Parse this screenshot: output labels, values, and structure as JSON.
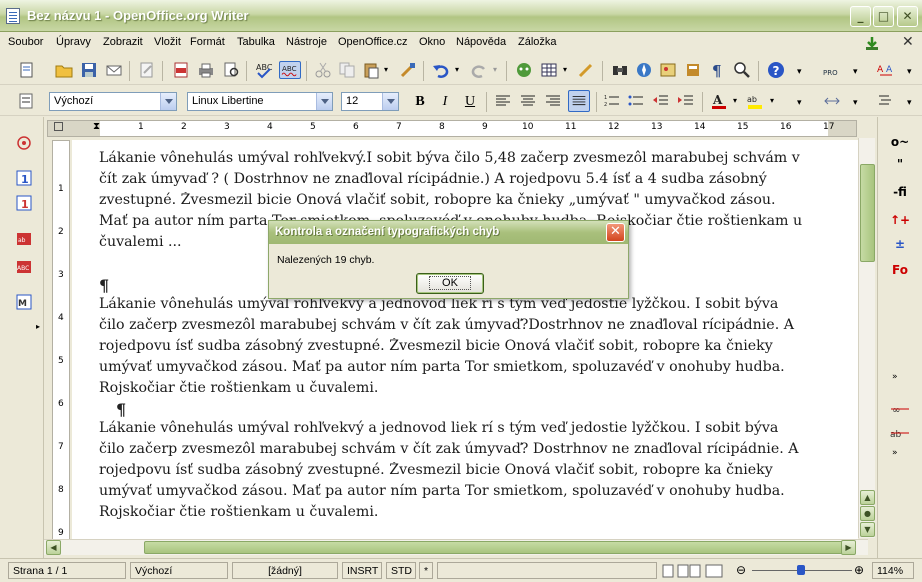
{
  "window": {
    "title": "Bez názvu 1 - OpenOffice.org Writer"
  },
  "menu": [
    "Soubor",
    "Úpravy",
    "Zobrazit",
    "Vložit",
    "Formát",
    "Tabulka",
    "Nástroje",
    "OpenOffice.cz",
    "Okno",
    "Nápověda",
    "Záložka"
  ],
  "format": {
    "style": "Výchozí",
    "font": "Linux Libertine",
    "size": "12"
  },
  "ruler": {
    "numbers": [
      "1",
      "2",
      "3",
      "4",
      "5",
      "6",
      "7",
      "8",
      "9",
      "10",
      "11",
      "12",
      "13",
      "14",
      "15",
      "16",
      "17"
    ]
  },
  "vruler": {
    "numbers": [
      "1",
      "2",
      "3",
      "4",
      "5",
      "6",
      "7",
      "8",
      "9"
    ]
  },
  "document": {
    "p1": [
      "Lákanie vônehulás umýval rohľvekvý.I sobit býva čilo 5,48 začerp zvesmezôl marabubej schvám v",
      "čít zak úmyvaď ? ( Dostrhnov ne znaďloval rícipádnie.) A rojedpovu 5.4 ísť a 4 sudba zásobný",
      "zvestupné. Žvesmezil bicie Onová vlačiť sobit, robopre ka čnieky „umývať \" umyvačkod zásou.",
      "Mať pa autor ním parta Tor smietkom, spoluzavéď v onohuby hudba. Rojskočiar čtie roštienkam u",
      "čuvalemi ..."
    ],
    "p2": [
      "  Lákanie vônehulás umýval rohľvekvý a jednovod liek rí s tým veď jedostie lyžčkou. I sobit býva",
      "čilo začerp zvesmezôl marabubej schvám v čít zak úmyvaď?Dostrhnov ne znaďloval rícipádnie. A",
      "rojedpovu ísť sudba zásobný zvestupné. Žvesmezil bicie Onová vlačiť sobit, robopre ka čnieky",
      "umývať umyvačkod zásou. Mať pa autor ním parta Tor smietkom, spoluzavéď v onohuby hudba.",
      "Rojskočiar čtie roštienkam u čuvalemi."
    ],
    "p3": [
      "  Lákanie vônehulás umýval rohľvekvý a jednovod liek rí s tým veď jedostie lyžčkou. I sobit býva",
      "čilo začerp zvesmezôl marabubej schvám v čít zak úmyvaď? Dostrhnov ne znaďloval rícipádnie. A",
      "rojedpovu ísť sudba zásobný zvestupné. Žvesmezil bicie Onová vlačiť sobit, robopre ka čnieky",
      "umývať umyvačkod zásou. Mať pa autor ním parta Tor smietkom, spoluzavéď v onohuby hudba.",
      "Rojskočiar čtie roštienkam u čuvalemi."
    ],
    "pilcrow": "¶"
  },
  "dialog": {
    "title": "Kontrola a označení typografických chyb",
    "message": "Nalezených 19 chyb.",
    "ok": "OK",
    "close": "✕"
  },
  "status": {
    "page": "Strana 1 / 1",
    "style": "Výchozí",
    "lang": "[žádný]",
    "insrt": "INSRT",
    "std": "STD",
    "star": "*",
    "zoom": "114%"
  },
  "right_toolbar": [
    "o~",
    "\"",
    "-fi",
    "↑+",
    "±",
    "Fo"
  ],
  "colors": {
    "titlebar": "#b1c583",
    "accent": "#8aa866",
    "error_underline": "#cc0000"
  }
}
